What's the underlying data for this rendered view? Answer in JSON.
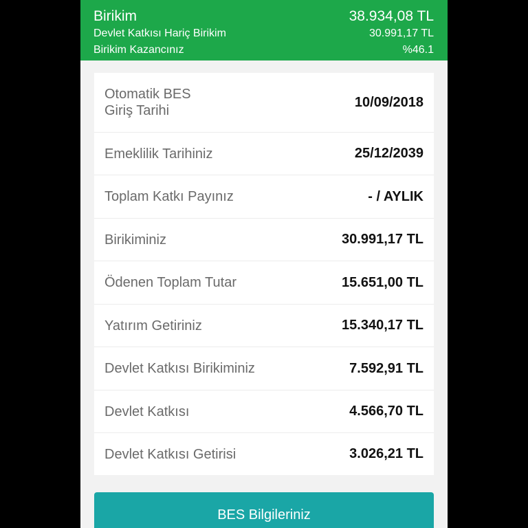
{
  "summary": {
    "title": "Birikim",
    "total": "38.934,08 TL",
    "excluding_label": "Devlet Katkısı Hariç Birikim",
    "excluding_value": "30.991,17 TL",
    "gain_label": "Birikim Kazancınız",
    "gain_value": "%46.1"
  },
  "details": [
    {
      "label": "Otomatik BES\nGiriş Tarihi",
      "value": "10/09/2018"
    },
    {
      "label": "Emeklilik Tarihiniz",
      "value": "25/12/2039"
    },
    {
      "label": "Toplam Katkı Payınız",
      "value": "- / AYLIK"
    },
    {
      "label": "Birikiminiz",
      "value": "30.991,17 TL"
    },
    {
      "label": "Ödenen Toplam Tutar",
      "value": "15.651,00 TL"
    },
    {
      "label": "Yatırım Getiriniz",
      "value": "15.340,17 TL"
    },
    {
      "label": "Devlet Katkısı Birikiminiz",
      "value": "7.592,91 TL"
    },
    {
      "label": "Devlet Katkısı",
      "value": "4.566,70 TL"
    },
    {
      "label": "Devlet Katkısı Getirisi",
      "value": "3.026,21 TL"
    }
  ],
  "button": {
    "label": "BES Bilgileriniz"
  },
  "colors": {
    "header_green": "#1da84a",
    "button_teal": "#1aa6a6",
    "background": "#f2f2f2"
  }
}
